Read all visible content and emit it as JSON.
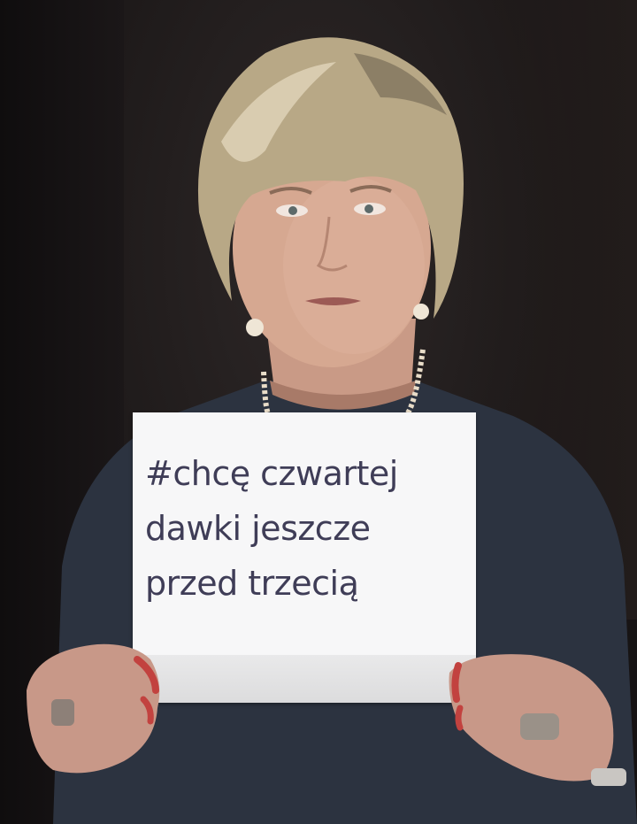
{
  "photo": {
    "description_colors": {
      "background": "#1d1919",
      "sweater": "#2c3340",
      "sign_paper": "#f7f7f8",
      "sign_text": "#3f3d57"
    }
  },
  "sign": {
    "lines": [
      "#chcę czwartej",
      "dawki jeszcze",
      "przed trzecią"
    ]
  }
}
